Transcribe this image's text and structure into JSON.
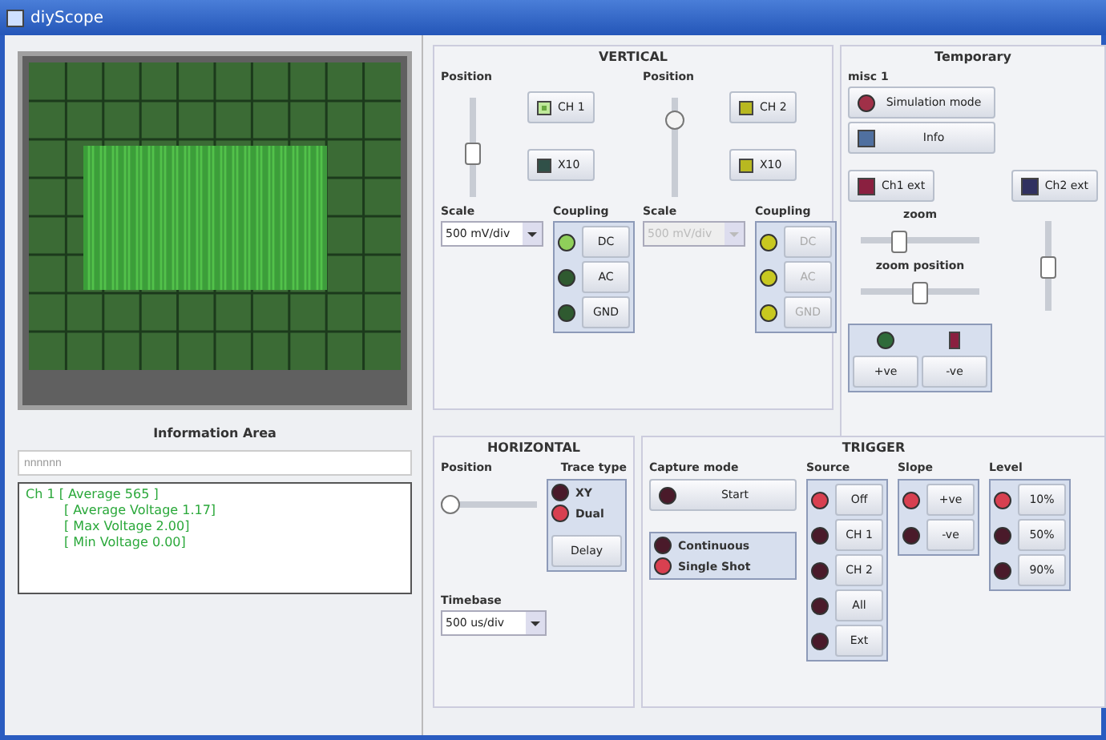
{
  "window": {
    "title": "diyScope"
  },
  "info": {
    "title": "Information Area",
    "field_value": "nnnnnn",
    "lines": [
      "Ch 1 [ Average 565 ]",
      "[ Average Voltage  1.17]",
      "[ Max Voltage  2.00]",
      "[ Min Voltage  0.00]"
    ]
  },
  "vertical": {
    "title": "VERTICAL",
    "channels": [
      {
        "position": {
          "label": "Position",
          "level": 0.45
        },
        "enable": {
          "label": "CH 1",
          "checked": true
        },
        "x10": {
          "label": "X10",
          "checked": false
        },
        "scale_label": "Scale",
        "scale": "500 mV/div",
        "coupling_label": "Coupling",
        "disabled": false,
        "coupling": [
          {
            "label": "DC",
            "on": true
          },
          {
            "label": "AC",
            "on": false
          },
          {
            "label": "GND",
            "on": false
          }
        ]
      },
      {
        "position": {
          "label": "Position",
          "level": 0.85
        },
        "enable": {
          "label": "CH 2",
          "checked": false
        },
        "x10": {
          "label": "X10",
          "checked": false
        },
        "scale_label": "Scale",
        "scale": "500 mV/div",
        "coupling_label": "Coupling",
        "disabled": true,
        "coupling": [
          {
            "label": "DC",
            "on": false
          },
          {
            "label": "AC",
            "on": false
          },
          {
            "label": "GND",
            "on": false
          }
        ]
      }
    ]
  },
  "temporary": {
    "title": "Temporary",
    "group_label": "misc 1",
    "buttons": [
      {
        "kind": "led",
        "label": "Simulation mode",
        "color": "#a03048"
      },
      {
        "kind": "square",
        "label": "Info",
        "color": "#5070a0"
      }
    ],
    "ext": [
      {
        "label": "Ch1 ext",
        "color": "#8a2040"
      },
      {
        "label": "Ch2 ext",
        "color": "#303060"
      }
    ],
    "sliders": [
      {
        "label": "zoom",
        "level": 0.3
      },
      {
        "label": "zoom position",
        "level": 0.5
      }
    ],
    "side_slider": {
      "level": 0.5
    },
    "indicators": [
      {
        "kind": "led",
        "color": "#2f6b3a"
      },
      {
        "kind": "square",
        "color": "#8a2040"
      }
    ],
    "slope_buttons": [
      "+ve",
      "-ve"
    ]
  },
  "horizontal": {
    "title": "HORIZONTAL",
    "position": {
      "label": "Position",
      "level": 0.0
    },
    "trace_label": "Trace type",
    "trace": [
      {
        "label": "XY",
        "on": false
      },
      {
        "label": "Dual",
        "on": true
      }
    ],
    "delay": "Delay",
    "timebase_label": "Timebase",
    "timebase": "500 us/div"
  },
  "trigger": {
    "title": "TRIGGER",
    "capture_label": "Capture mode",
    "start": {
      "label": "Start",
      "on": false
    },
    "modes": [
      {
        "label": "Continuous",
        "on": false
      },
      {
        "label": "Single Shot",
        "on": true
      }
    ],
    "source_label": "Source",
    "source": [
      {
        "label": "Off",
        "on": true
      },
      {
        "label": "CH 1",
        "on": false
      },
      {
        "label": "CH 2",
        "on": false
      },
      {
        "label": "All",
        "on": false
      },
      {
        "label": "Ext",
        "on": false
      }
    ],
    "slope_label": "Slope",
    "slope": [
      {
        "label": "+ve",
        "on": true
      },
      {
        "label": "-ve",
        "on": false
      }
    ],
    "level_label": "Level",
    "level": [
      {
        "label": "10%",
        "on": true
      },
      {
        "label": "50%",
        "on": false
      },
      {
        "label": "90%",
        "on": false
      }
    ]
  }
}
